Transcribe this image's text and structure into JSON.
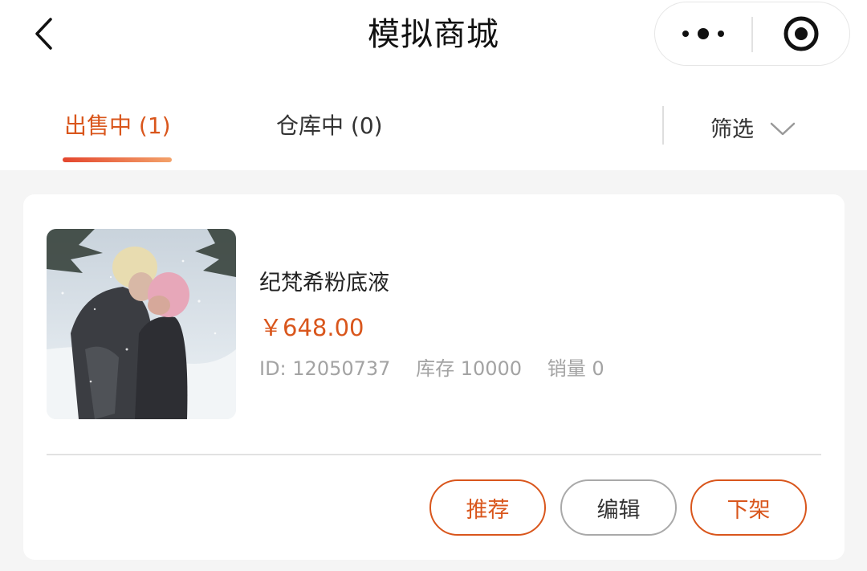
{
  "header": {
    "title": "模拟商城",
    "back_icon": "chevron-left-icon",
    "more_icon": "more-dots-icon",
    "close_icon": "target-close-icon"
  },
  "tabs": {
    "items": [
      {
        "label": "出售中 (1)",
        "active": true
      },
      {
        "label": "仓库中 (0)",
        "active": false
      }
    ],
    "filter_label": "筛选",
    "filter_icon": "chevron-down-icon"
  },
  "product": {
    "name": "纪梵希粉底液",
    "price": "￥648.00",
    "id_text": "ID: 12050737",
    "stock_text": "库存 10000",
    "sales_text": "销量 0"
  },
  "actions": {
    "recommend": "推荐",
    "edit": "编辑",
    "offshelf": "下架"
  },
  "colors": {
    "accent": "#d9561c",
    "underline_start": "#e4462e",
    "underline_end": "#f3a26a",
    "page_bg": "#f5f5f5"
  }
}
